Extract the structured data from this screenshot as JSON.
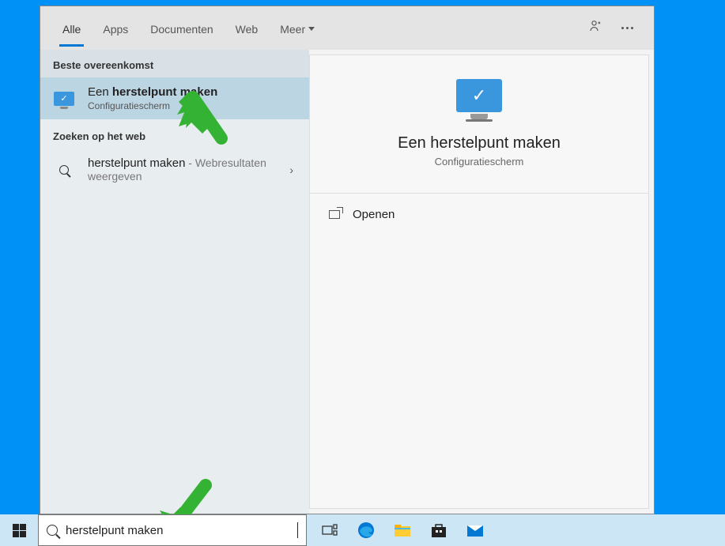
{
  "tabs": {
    "all": "Alle",
    "apps": "Apps",
    "documents": "Documenten",
    "web": "Web",
    "more": "Meer"
  },
  "sections": {
    "best_match": "Beste overeenkomst",
    "web": "Zoeken op het web"
  },
  "best_match": {
    "title_prefix": "Een ",
    "title_bold": "herstelpunt maken",
    "subtitle": "Configuratiescherm"
  },
  "web_result": {
    "title": "herstelpunt maken",
    "suffix": " - Webresultaten weergeven"
  },
  "preview": {
    "title": "Een herstelpunt maken",
    "subtitle": "Configuratiescherm",
    "open": "Openen"
  },
  "search": {
    "value": "herstelpunt maken"
  }
}
